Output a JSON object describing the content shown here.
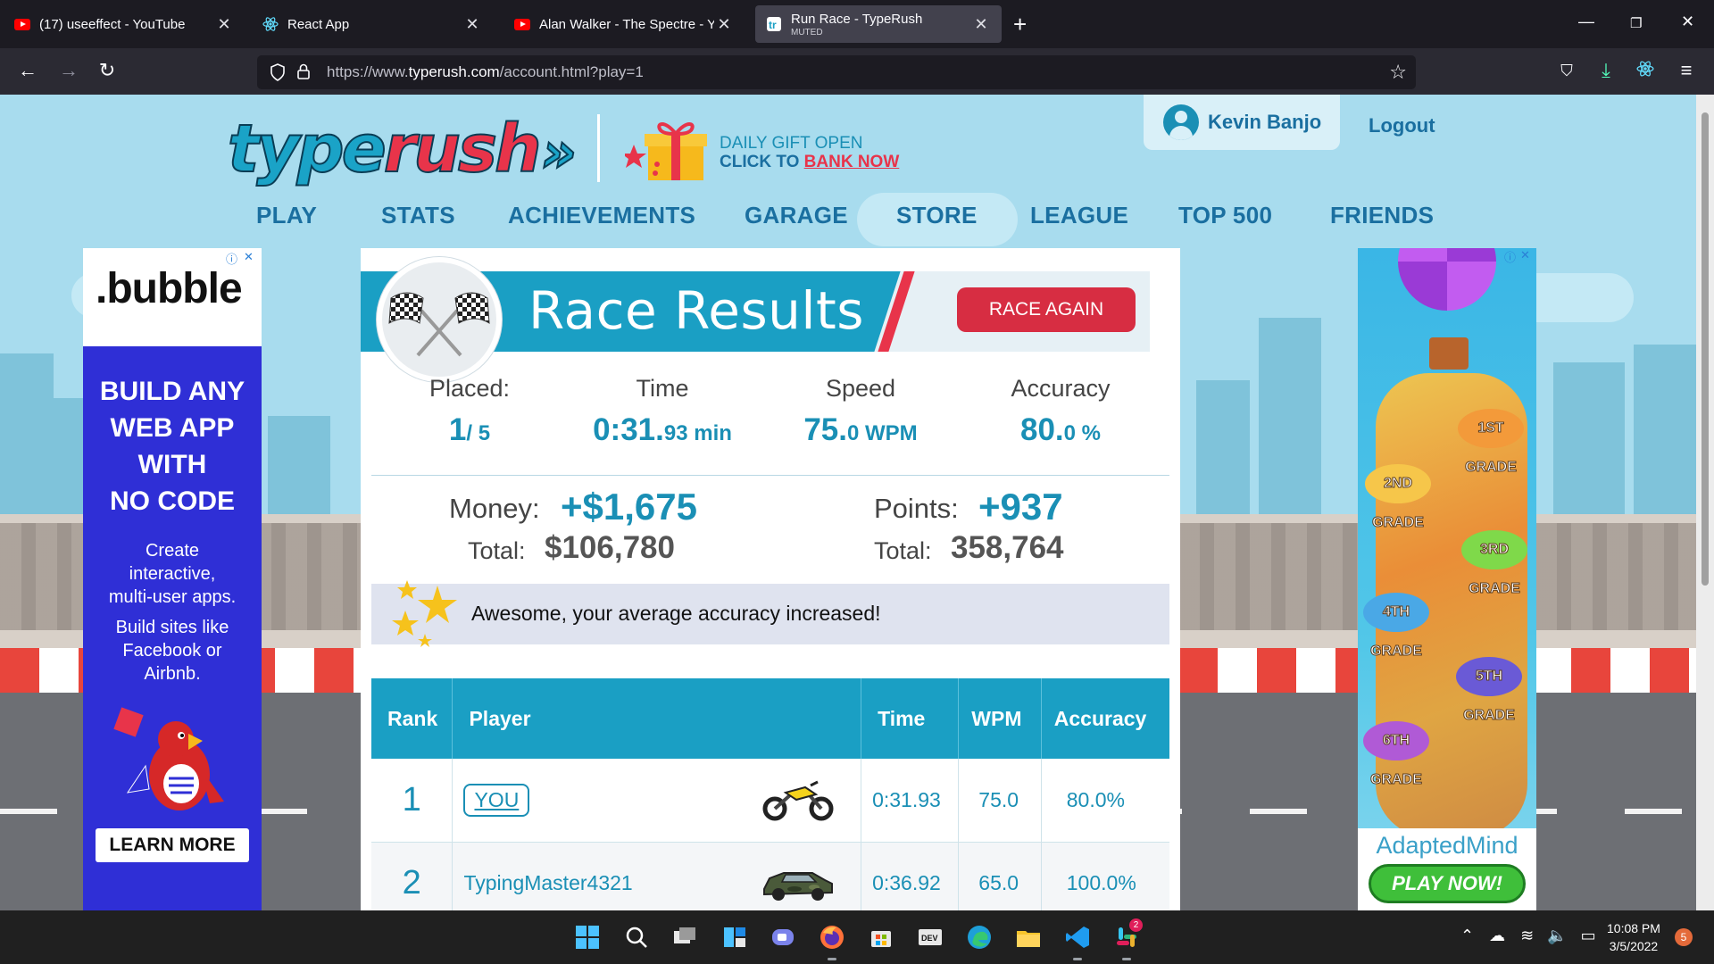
{
  "browser": {
    "tabs": [
      {
        "title": "(17) useeffect - YouTube",
        "icon": "youtube-icon"
      },
      {
        "title": "React App",
        "icon": "react-icon"
      },
      {
        "title": "Alan Walker - The Spectre - You",
        "icon": "youtube-icon"
      },
      {
        "title": "Run Race - TypeRush",
        "subtitle": "MUTED",
        "icon": "typerush-icon",
        "active": true
      }
    ],
    "url_prefix": "https://www.",
    "url_domain": "typerush.com",
    "url_path": "/account.html?play=1"
  },
  "header": {
    "logo_part1": "type",
    "logo_part2": "rush",
    "logo_arrows": "»",
    "gift_line1": "DAILY GIFT OPEN",
    "gift_line2_prefix": "CLICK TO ",
    "gift_link": "BANK NOW",
    "user_name": "Kevin Banjo",
    "logout": "Logout"
  },
  "nav": [
    "PLAY",
    "STATS",
    "ACHIEVEMENTS",
    "GARAGE",
    "STORE",
    "LEAGUE",
    "TOP 500",
    "FRIENDS"
  ],
  "results": {
    "title": "Race Results",
    "race_again": "RACE AGAIN",
    "stats": {
      "placed_label": "Placed:",
      "placed_value": "1",
      "placed_total": "/ 5",
      "time_label": "Time",
      "time_value": "0:31.",
      "time_small": "93 min",
      "speed_label": "Speed",
      "speed_value": "75.",
      "speed_small": "0 WPM",
      "accuracy_label": "Accuracy",
      "accuracy_value": "80.",
      "accuracy_small": "0 %"
    },
    "money_label": "Money:",
    "money_value": "+$1,675",
    "money_total_label": "Total:",
    "money_total": "$106,780",
    "points_label": "Points:",
    "points_value": "+937",
    "points_total_label": "Total:",
    "points_total": "358,764",
    "notice": "Awesome, your average accuracy increased!",
    "table": {
      "headers": [
        "Rank",
        "Player",
        "Time",
        "WPM",
        "Accuracy"
      ],
      "rows": [
        {
          "rank": "1",
          "player": "YOU",
          "vehicle": "motorcycle-icon",
          "time": "0:31.93",
          "wpm": "75.0",
          "accuracy": "80.0%"
        },
        {
          "rank": "2",
          "player": "TypingMaster4321",
          "vehicle": "camo-car-icon",
          "time": "0:36.92",
          "wpm": "65.0",
          "accuracy": "100.0%"
        }
      ]
    }
  },
  "ads": {
    "left": {
      "logo": ".bubble",
      "headline": [
        "BUILD ANY",
        "WEB APP",
        "WITH",
        "NO CODE"
      ],
      "sub1": [
        "Create",
        "interactive,",
        "multi-user apps."
      ],
      "sub2": [
        "Build sites like",
        "Facebook or",
        "Airbnb."
      ],
      "cta": "LEARN MORE"
    },
    "right": {
      "grades": [
        "1ST GRADE",
        "2ND GRADE",
        "3RD GRADE",
        "4TH GRADE",
        "5TH GRADE",
        "6TH GRADE"
      ],
      "brand": "AdaptedMind",
      "cta": "PLAY NOW!"
    }
  },
  "taskbar": {
    "time": "10:08 PM",
    "date": "3/5/2022",
    "notifications": "5",
    "slack_badge": "2"
  },
  "colors": {
    "brand_blue": "#1a9fc4",
    "brand_red": "#e8344a",
    "sky": "#a8dcee"
  }
}
